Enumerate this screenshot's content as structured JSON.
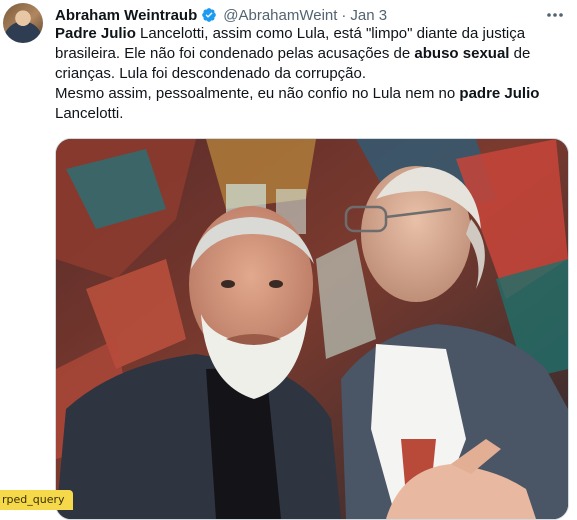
{
  "tweet": {
    "author_name": "Abraham Weintraub",
    "handle": "@AbrahamWeint",
    "separator": "·",
    "date": "Jan 3",
    "paragraphs": [
      [
        {
          "text": "Padre Julio",
          "bold": true
        },
        {
          "text": " Lancelotti, assim como Lula, está \"limpo\" diante da justiça brasileira. Ele não foi condenado pelas acusações de ",
          "bold": false
        },
        {
          "text": "abuso sexual",
          "bold": true
        },
        {
          "text": " de crianças. Lula foi descondenado da corrupção.",
          "bold": false
        }
      ],
      [
        {
          "text": "Mesmo assim, pessoalmente, eu não confio no Lula nem no ",
          "bold": false
        },
        {
          "text": "padre Julio",
          "bold": true
        },
        {
          "text": " Lancelotti.",
          "bold": false
        }
      ]
    ],
    "icons": {
      "verified": "verified-badge-icon",
      "more": "more-options-icon"
    },
    "colors": {
      "verified": "#1d9bf0",
      "secondary_text": "#536471",
      "primary_text": "#0f1419"
    }
  },
  "overlay": {
    "tag_label": "rped_query"
  }
}
